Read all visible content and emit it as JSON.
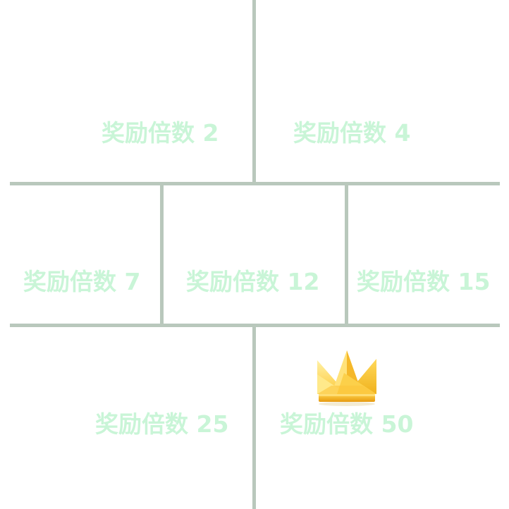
{
  "colors": {
    "background": "#ffffff",
    "divider": "#b9c8bc",
    "label": "#c9f5d7",
    "crown_light": "#ffe98a",
    "crown_mid": "#fcc93a",
    "crown_dark": "#e8a616"
  },
  "tiles": [
    {
      "label": "奖励倍数 2"
    },
    {
      "label": "奖励倍数 4"
    },
    {
      "label": "奖励倍数 7"
    },
    {
      "label": "奖励倍数 12"
    },
    {
      "label": "奖励倍数 15"
    },
    {
      "label": "奖励倍数 25"
    },
    {
      "label": "奖励倍数 50",
      "icon": "crown-icon"
    }
  ]
}
